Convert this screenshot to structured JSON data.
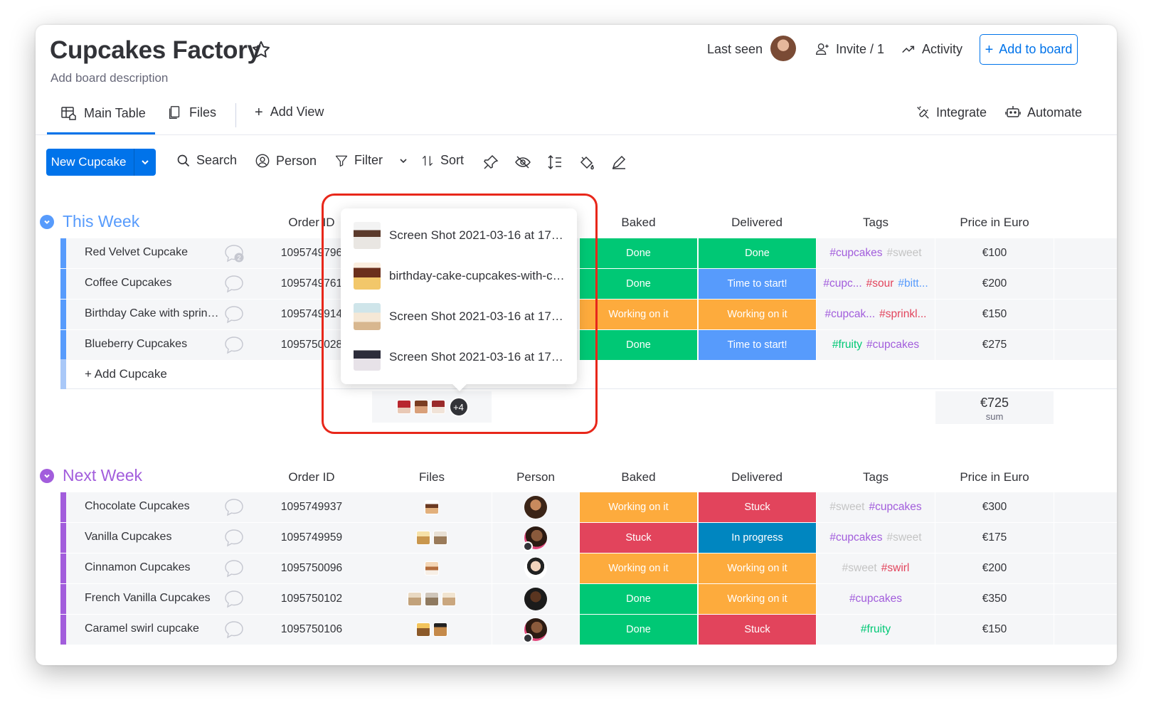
{
  "board": {
    "title": "Cupcakes Factory",
    "description": "Add board description"
  },
  "header": {
    "last_seen": "Last seen",
    "invite": "Invite / 1",
    "activity": "Activity",
    "add_to_board": "Add to board"
  },
  "tabs": {
    "main_table": "Main Table",
    "files": "Files",
    "add_view": "Add View",
    "integrate": "Integrate",
    "automate": "Automate"
  },
  "toolbar": {
    "new_item": "New Cupcake",
    "search": "Search",
    "person": "Person",
    "filter": "Filter",
    "sort": "Sort"
  },
  "columns": {
    "order_id": "Order ID",
    "files": "Files",
    "person": "Person",
    "baked": "Baked",
    "delivered": "Delivered",
    "tags": "Tags",
    "price": "Price in Euro"
  },
  "colors": {
    "accent": "#0073ea",
    "done": "#00c875",
    "working": "#fdab3d",
    "stuck": "#e2445c",
    "time_to_start": "#579bfc",
    "in_progress": "#0086c0",
    "group_this_week": "#579bfc",
    "group_next_week": "#a25ddc"
  },
  "group_this_week": {
    "title": "This Week",
    "add_item": "+ Add Cupcake",
    "sum_value": "€725",
    "sum_label": "sum",
    "files_more": "+4",
    "rows": [
      {
        "name": "Red Velvet Cupcake",
        "order_id": "1095749796",
        "comments": "2",
        "baked": "Done",
        "delivered": "Done",
        "tags": [
          {
            "text": "#cupcakes",
            "color": "#a25ddc"
          },
          {
            "text": "#sweet",
            "color": "#c4c4c4"
          }
        ],
        "price": "€100"
      },
      {
        "name": "Coffee Cupcakes",
        "order_id": "1095749761",
        "baked": "Done",
        "delivered": "Time to start!",
        "tags": [
          {
            "text": "#cupc...",
            "color": "#a25ddc"
          },
          {
            "text": "#sour",
            "color": "#e2445c"
          },
          {
            "text": "#bitt...",
            "color": "#579bfc"
          }
        ],
        "price": "€200"
      },
      {
        "name": "Birthday Cake with sprinkl...",
        "order_id": "1095749914",
        "baked": "Working on it",
        "delivered": "Working on it",
        "tags": [
          {
            "text": "#cupcak...",
            "color": "#a25ddc"
          },
          {
            "text": "#sprinkl...",
            "color": "#e2445c"
          }
        ],
        "price": "€150"
      },
      {
        "name": "Blueberry Cupcakes",
        "order_id": "1095750028",
        "baked": "Done",
        "delivered": "Time to start!",
        "tags": [
          {
            "text": "#fruity",
            "color": "#00c875"
          },
          {
            "text": "#cupcakes",
            "color": "#a25ddc"
          }
        ],
        "price": "€275"
      }
    ]
  },
  "files_popup": {
    "items": [
      "Screen Shot 2021-03-16 at 17.4...",
      "birthday-cake-cupcakes-with-ch...",
      "Screen Shot 2021-03-16 at 17.3...",
      "Screen Shot 2021-03-16 at 17.3..."
    ]
  },
  "group_next_week": {
    "title": "Next Week",
    "rows": [
      {
        "name": "Chocolate Cupcakes",
        "order_id": "1095749937",
        "baked": "Working on it",
        "delivered": "Stuck",
        "tags": [
          {
            "text": "#sweet",
            "color": "#c4c4c4"
          },
          {
            "text": "#cupcakes",
            "color": "#a25ddc"
          }
        ],
        "price": "€300"
      },
      {
        "name": "Vanilla Cupcakes",
        "order_id": "1095749959",
        "baked": "Stuck",
        "delivered": "In progress",
        "tags": [
          {
            "text": "#cupcakes",
            "color": "#a25ddc"
          },
          {
            "text": "#sweet",
            "color": "#c4c4c4"
          }
        ],
        "price": "€175"
      },
      {
        "name": "Cinnamon Cupcakes",
        "order_id": "1095750096",
        "baked": "Working on it",
        "delivered": "Working on it",
        "tags": [
          {
            "text": "#sweet",
            "color": "#c4c4c4"
          },
          {
            "text": "#swirl",
            "color": "#e2445c"
          }
        ],
        "price": "€200"
      },
      {
        "name": "French Vanilla Cupcakes",
        "order_id": "1095750102",
        "baked": "Done",
        "delivered": "Working on it",
        "tags": [
          {
            "text": "#cupcakes",
            "color": "#a25ddc"
          }
        ],
        "price": "€350"
      },
      {
        "name": "Caramel swirl cupcake",
        "order_id": "1095750106",
        "baked": "Done",
        "delivered": "Stuck",
        "tags": [
          {
            "text": "#fruity",
            "color": "#00c875"
          }
        ],
        "price": "€150"
      }
    ]
  }
}
